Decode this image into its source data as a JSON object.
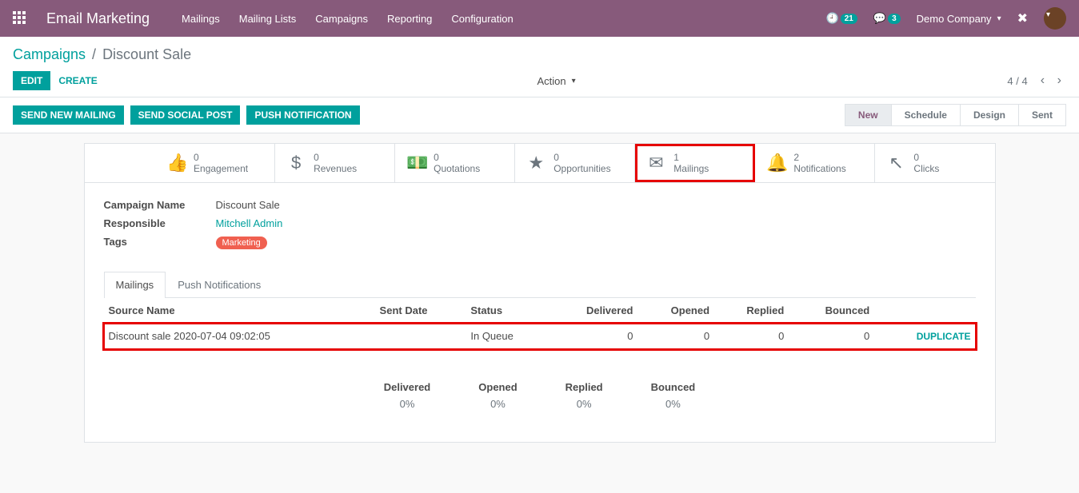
{
  "topbar": {
    "brand": "Email Marketing",
    "nav": [
      "Mailings",
      "Mailing Lists",
      "Campaigns",
      "Reporting",
      "Configuration"
    ],
    "clock_badge": "21",
    "chat_badge": "3",
    "company": "Demo Company"
  },
  "breadcrumb": {
    "root": "Campaigns",
    "current": "Discount Sale"
  },
  "buttons": {
    "edit": "Edit",
    "create": "Create",
    "action": "Action",
    "send_new_mailing": "Send New Mailing",
    "send_social_post": "Send Social Post",
    "push_notification": "Push Notification"
  },
  "pager": {
    "position": "4 / 4"
  },
  "status_steps": [
    "New",
    "Schedule",
    "Design",
    "Sent"
  ],
  "status_active_index": 0,
  "stats": [
    {
      "count": "0",
      "label": "Engagement",
      "icon": "thumbs-up"
    },
    {
      "count": "0",
      "label": "Revenues",
      "icon": "dollar"
    },
    {
      "count": "0",
      "label": "Quotations",
      "icon": "money"
    },
    {
      "count": "0",
      "label": "Opportunities",
      "icon": "star"
    },
    {
      "count": "1",
      "label": "Mailings",
      "icon": "envelope"
    },
    {
      "count": "2",
      "label": "Notifications",
      "icon": "bell"
    },
    {
      "count": "0",
      "label": "Clicks",
      "icon": "cursor"
    }
  ],
  "fields": {
    "campaign_name_label": "Campaign Name",
    "campaign_name_value": "Discount Sale",
    "responsible_label": "Responsible",
    "responsible_value": "Mitchell Admin",
    "tags_label": "Tags",
    "tags_value": "Marketing"
  },
  "tabs": {
    "mailings": "Mailings",
    "push": "Push Notifications"
  },
  "table": {
    "headers": {
      "source": "Source Name",
      "sent_date": "Sent Date",
      "status": "Status",
      "delivered": "Delivered",
      "opened": "Opened",
      "replied": "Replied",
      "bounced": "Bounced"
    },
    "rows": [
      {
        "source": "Discount sale 2020-07-04 09:02:05",
        "sent_date": "",
        "status": "In Queue",
        "delivered": "0",
        "opened": "0",
        "replied": "0",
        "bounced": "0",
        "action": "Duplicate"
      }
    ]
  },
  "summary": {
    "delivered_label": "Delivered",
    "delivered_value": "0%",
    "opened_label": "Opened",
    "opened_value": "0%",
    "replied_label": "Replied",
    "replied_value": "0%",
    "bounced_label": "Bounced",
    "bounced_value": "0%"
  }
}
